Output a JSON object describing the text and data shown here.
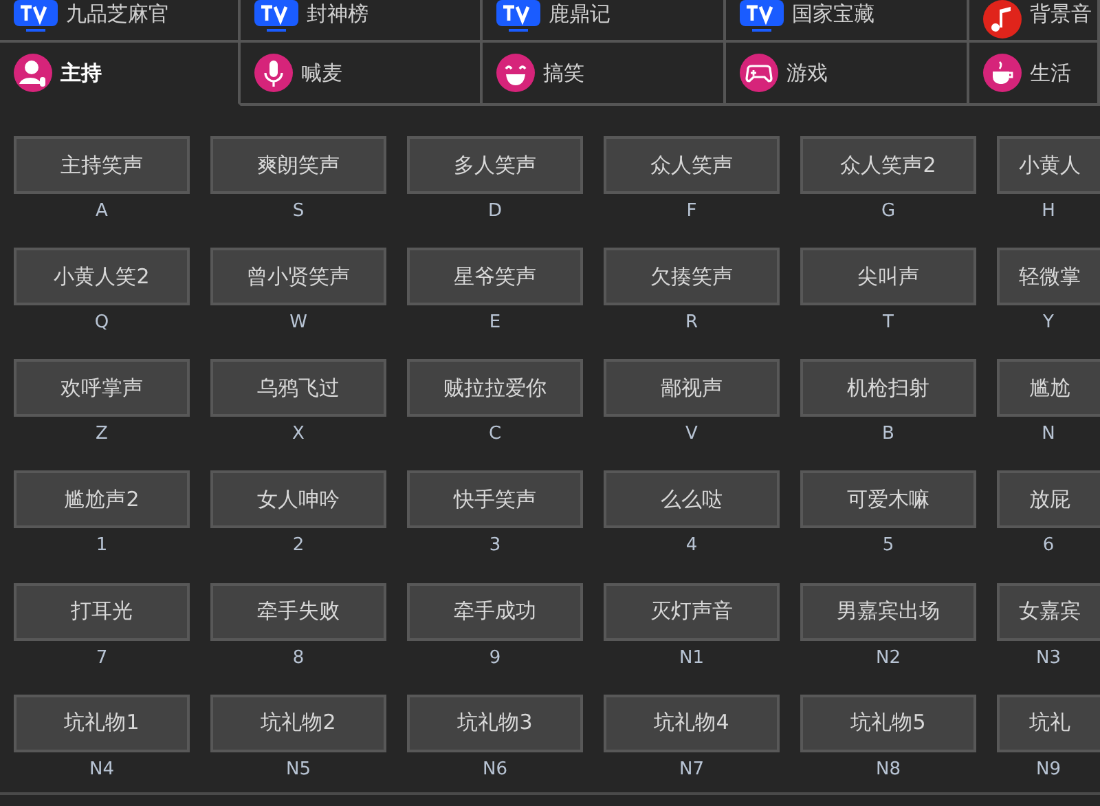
{
  "tab_rows": [
    {
      "tabs": [
        {
          "label": "九品芝麻官",
          "selected": false
        },
        {
          "label": "封神榜",
          "selected": false
        },
        {
          "label": "鹿鼎记",
          "selected": false
        },
        {
          "label": "国家宝藏",
          "selected": false
        },
        {
          "label": "背景音",
          "selected": false
        }
      ]
    },
    {
      "tabs": [
        {
          "label": "主持",
          "selected": true
        },
        {
          "label": "喊麦",
          "selected": false
        },
        {
          "label": "搞笑",
          "selected": false
        },
        {
          "label": "游戏",
          "selected": false
        },
        {
          "label": "生活",
          "selected": false
        }
      ]
    }
  ],
  "sounds": [
    {
      "label": "主持笑声",
      "key": "A"
    },
    {
      "label": "爽朗笑声",
      "key": "S"
    },
    {
      "label": "多人笑声",
      "key": "D"
    },
    {
      "label": "众人笑声",
      "key": "F"
    },
    {
      "label": "众人笑声2",
      "key": "G"
    },
    {
      "label": "小黄人",
      "key": "H"
    },
    {
      "label": "小黄人笑2",
      "key": "Q"
    },
    {
      "label": "曾小贤笑声",
      "key": "W"
    },
    {
      "label": "星爷笑声",
      "key": "E"
    },
    {
      "label": "欠揍笑声",
      "key": "R"
    },
    {
      "label": "尖叫声",
      "key": "T"
    },
    {
      "label": "轻微掌",
      "key": "Y"
    },
    {
      "label": "欢呼掌声",
      "key": "Z"
    },
    {
      "label": "乌鸦飞过",
      "key": "X"
    },
    {
      "label": "贼拉拉爱你",
      "key": "C"
    },
    {
      "label": "鄙视声",
      "key": "V"
    },
    {
      "label": "机枪扫射",
      "key": "B"
    },
    {
      "label": "尴尬",
      "key": "N"
    },
    {
      "label": "尴尬声2",
      "key": "1"
    },
    {
      "label": "女人呻吟",
      "key": "2"
    },
    {
      "label": "快手笑声",
      "key": "3"
    },
    {
      "label": "么么哒",
      "key": "4"
    },
    {
      "label": "可爱木嘛",
      "key": "5"
    },
    {
      "label": "放屁",
      "key": "6"
    },
    {
      "label": "打耳光",
      "key": "7"
    },
    {
      "label": "牵手失败",
      "key": "8"
    },
    {
      "label": "牵手成功",
      "key": "9"
    },
    {
      "label": "灭灯声音",
      "key": "N1"
    },
    {
      "label": "男嘉宾出场",
      "key": "N2"
    },
    {
      "label": "女嘉宾",
      "key": "N3"
    },
    {
      "label": "坑礼物1",
      "key": "N4"
    },
    {
      "label": "坑礼物2",
      "key": "N5"
    },
    {
      "label": "坑礼物3",
      "key": "N6"
    },
    {
      "label": "坑礼物4",
      "key": "N7"
    },
    {
      "label": "坑礼物5",
      "key": "N8"
    },
    {
      "label": "坑礼",
      "key": "N9"
    }
  ]
}
